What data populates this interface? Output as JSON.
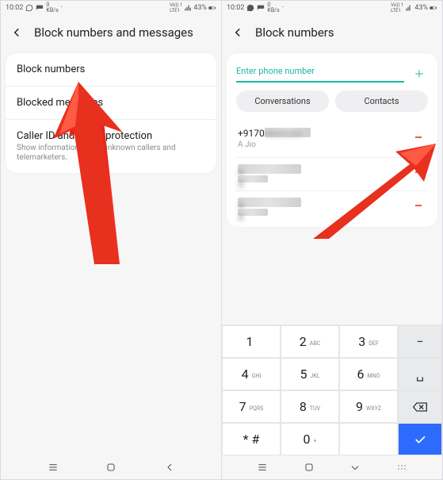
{
  "status": {
    "time": "10:02",
    "battery_text": "43%",
    "net_text": "VoLTE1",
    "speed": "0 KB/s"
  },
  "left": {
    "title": "Block numbers and messages",
    "items": [
      {
        "title": "Block numbers",
        "sub": ""
      },
      {
        "title": "Blocked messages",
        "sub": ""
      },
      {
        "title": "Caller ID and spam protection",
        "sub": "Show information about unknown callers and telemarketers."
      }
    ]
  },
  "right": {
    "title": "Block numbers",
    "input_placeholder": "Enter phone number",
    "pill_conversations": "Conversations",
    "pill_contacts": "Contacts",
    "blocked": [
      {
        "number": "+9170",
        "sub": "A Jio",
        "blur_num": true
      },
      {
        "number": "",
        "sub": "",
        "blur_all": true
      },
      {
        "number": "",
        "sub": "",
        "blur_all": true
      }
    ],
    "keypad": {
      "rows": [
        [
          {
            "d": "1",
            "l": ""
          },
          {
            "d": "2",
            "l": "ABC"
          },
          {
            "d": "3",
            "l": "DEF"
          }
        ],
        [
          {
            "d": "4",
            "l": "GHI"
          },
          {
            "d": "5",
            "l": "JKL"
          },
          {
            "d": "6",
            "l": "MNO"
          }
        ],
        [
          {
            "d": "7",
            "l": "PQRS"
          },
          {
            "d": "8",
            "l": "TUV"
          },
          {
            "d": "9",
            "l": "WXYZ"
          }
        ],
        [
          {
            "d": "* #",
            "l": ""
          },
          {
            "d": "0",
            "l": "+"
          },
          {
            "d": "",
            "l": ""
          }
        ]
      ],
      "side": [
        "minus",
        "space",
        "backspace",
        "ok"
      ]
    }
  }
}
